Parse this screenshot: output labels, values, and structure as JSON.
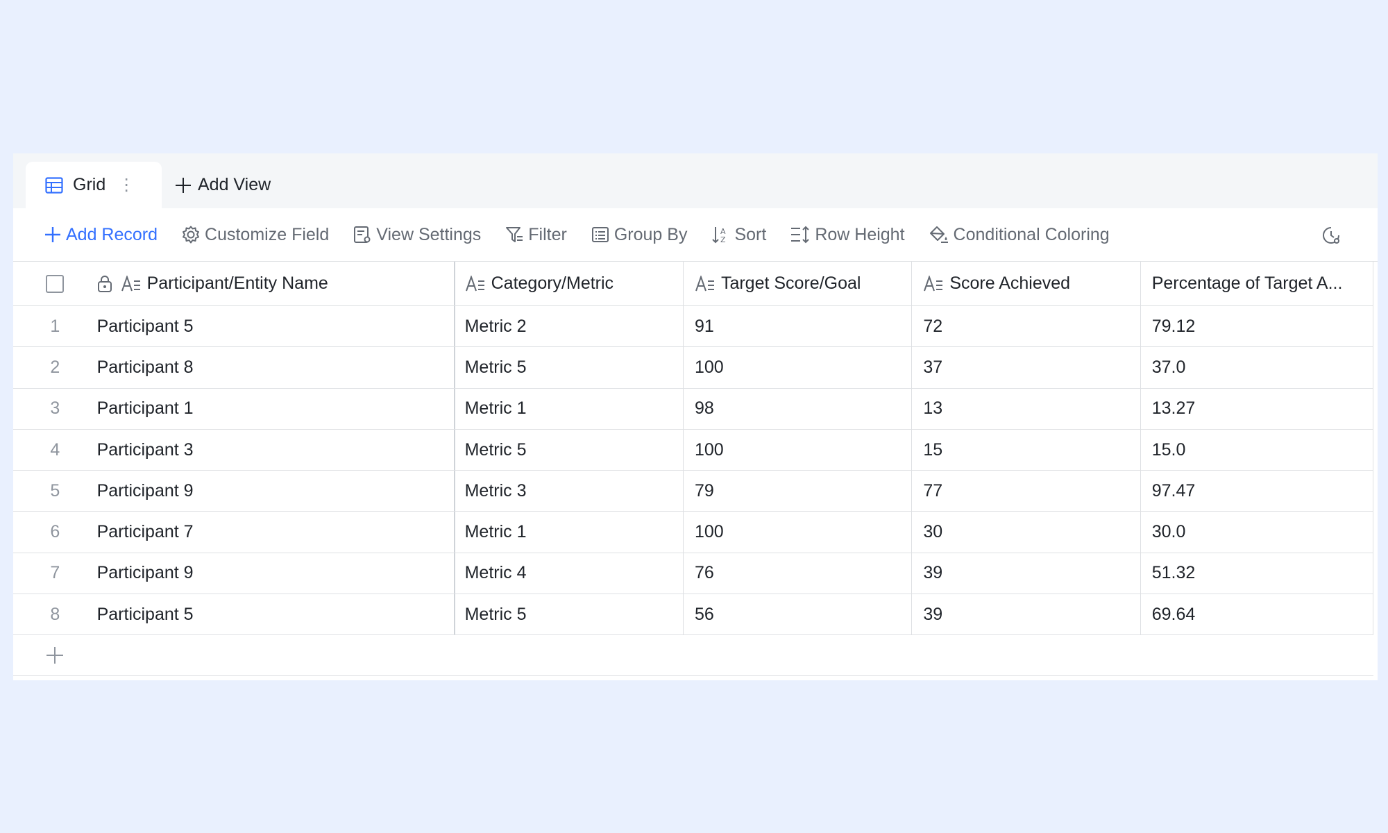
{
  "tabs": {
    "grid_label": "Grid",
    "add_view_label": "Add View"
  },
  "toolbar": {
    "add_record": "Add Record",
    "customize_field": "Customize Field",
    "view_settings": "View Settings",
    "filter": "Filter",
    "group_by": "Group By",
    "sort": "Sort",
    "row_height": "Row Height",
    "conditional_coloring": "Conditional Coloring"
  },
  "columns": {
    "name": "Participant/Entity Name",
    "category": "Category/Metric",
    "target": "Target Score/Goal",
    "score": "Score Achieved",
    "percentage": "Percentage of Target A..."
  },
  "rows": [
    {
      "idx": "1",
      "name": "Participant 5",
      "category": "Metric 2",
      "target": "91",
      "score": "72",
      "percentage": "79.12"
    },
    {
      "idx": "2",
      "name": "Participant 8",
      "category": "Metric 5",
      "target": "100",
      "score": "37",
      "percentage": "37.0"
    },
    {
      "idx": "3",
      "name": "Participant 1",
      "category": "Metric 1",
      "target": "98",
      "score": "13",
      "percentage": "13.27"
    },
    {
      "idx": "4",
      "name": "Participant 3",
      "category": "Metric 5",
      "target": "100",
      "score": "15",
      "percentage": "15.0"
    },
    {
      "idx": "5",
      "name": "Participant 9",
      "category": "Metric 3",
      "target": "79",
      "score": "77",
      "percentage": "97.47"
    },
    {
      "idx": "6",
      "name": "Participant 7",
      "category": "Metric 1",
      "target": "100",
      "score": "30",
      "percentage": "30.0"
    },
    {
      "idx": "7",
      "name": "Participant 9",
      "category": "Metric 4",
      "target": "76",
      "score": "39",
      "percentage": "51.32"
    },
    {
      "idx": "8",
      "name": "Participant 5",
      "category": "Metric 5",
      "target": "56",
      "score": "39",
      "percentage": "69.64"
    }
  ],
  "colors": {
    "accent": "#3370ff",
    "background": "#e9f0fe",
    "muted_text": "#646a73"
  },
  "icons": {
    "grid_tab": "grid-table-icon",
    "text_field": "text-field-icon",
    "lock": "lock-icon",
    "history": "history-icon"
  }
}
